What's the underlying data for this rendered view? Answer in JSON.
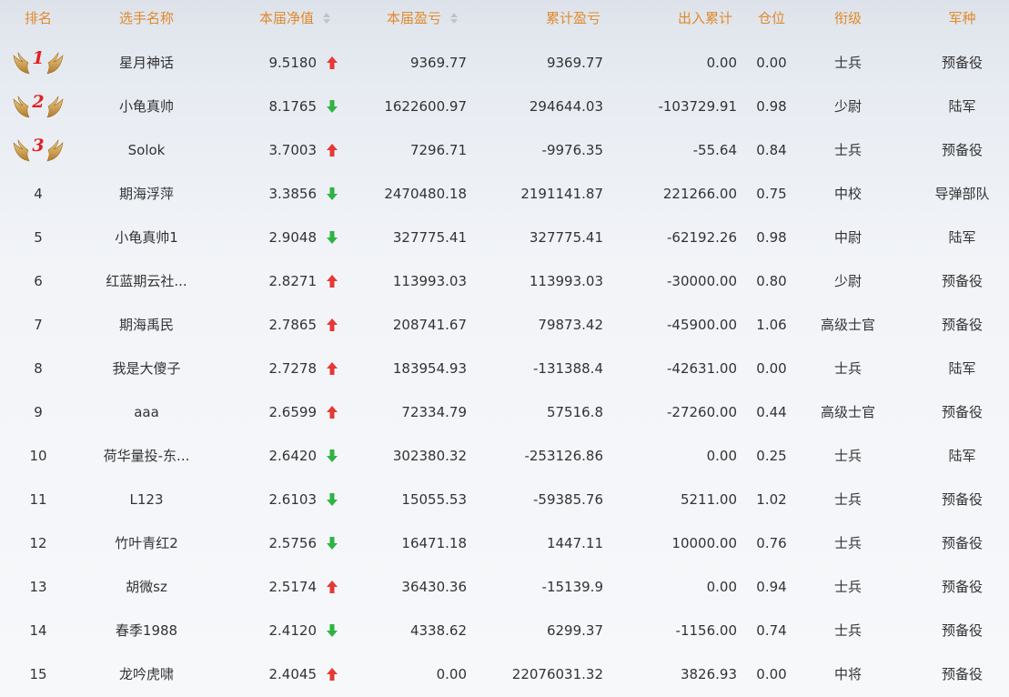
{
  "columns": {
    "rank": "排名",
    "name": "选手名称",
    "nav": "本届净值",
    "pnl": "本届盈亏",
    "cum_pnl": "累计盈亏",
    "flow": "出入累计",
    "position": "仓位",
    "title": "衔级",
    "branch": "军种"
  },
  "colors": {
    "header_text": "#e08a2c",
    "up": "#e53935",
    "down": "#2fb344",
    "medal_number": "#e02020"
  },
  "rows": [
    {
      "rank": "1",
      "medal": true,
      "name": "星月神话",
      "nav": "9.5180",
      "trend": "up",
      "pnl": "9369.77",
      "cum": "9369.77",
      "flow": "0.00",
      "pos": "0.00",
      "title": "士兵",
      "branch": "预备役"
    },
    {
      "rank": "2",
      "medal": true,
      "name": "小龟真帅",
      "nav": "8.1765",
      "trend": "down",
      "pnl": "1622600.97",
      "cum": "294644.03",
      "flow": "-103729.91",
      "pos": "0.98",
      "title": "少尉",
      "branch": "陆军"
    },
    {
      "rank": "3",
      "medal": true,
      "name": "Solok",
      "nav": "3.7003",
      "trend": "up",
      "pnl": "7296.71",
      "cum": "-9976.35",
      "flow": "-55.64",
      "pos": "0.84",
      "title": "士兵",
      "branch": "预备役"
    },
    {
      "rank": "4",
      "medal": false,
      "name": "期海浮萍",
      "nav": "3.3856",
      "trend": "down",
      "pnl": "2470480.18",
      "cum": "2191141.87",
      "flow": "221266.00",
      "pos": "0.75",
      "title": "中校",
      "branch": "导弹部队"
    },
    {
      "rank": "5",
      "medal": false,
      "name": "小龟真帅1",
      "nav": "2.9048",
      "trend": "down",
      "pnl": "327775.41",
      "cum": "327775.41",
      "flow": "-62192.26",
      "pos": "0.98",
      "title": "中尉",
      "branch": "陆军"
    },
    {
      "rank": "6",
      "medal": false,
      "name": "红蓝期云社...",
      "nav": "2.8271",
      "trend": "up",
      "pnl": "113993.03",
      "cum": "113993.03",
      "flow": "-30000.00",
      "pos": "0.80",
      "title": "少尉",
      "branch": "预备役"
    },
    {
      "rank": "7",
      "medal": false,
      "name": "期海禹民",
      "nav": "2.7865",
      "trend": "up",
      "pnl": "208741.67",
      "cum": "79873.42",
      "flow": "-45900.00",
      "pos": "1.06",
      "title": "高级士官",
      "branch": "预备役"
    },
    {
      "rank": "8",
      "medal": false,
      "name": "我是大傻子",
      "nav": "2.7278",
      "trend": "up",
      "pnl": "183954.93",
      "cum": "-131388.4",
      "flow": "-42631.00",
      "pos": "0.00",
      "title": "士兵",
      "branch": "陆军"
    },
    {
      "rank": "9",
      "medal": false,
      "name": "aaa",
      "nav": "2.6599",
      "trend": "up",
      "pnl": "72334.79",
      "cum": "57516.8",
      "flow": "-27260.00",
      "pos": "0.44",
      "title": "高级士官",
      "branch": "预备役"
    },
    {
      "rank": "10",
      "medal": false,
      "name": "荷华量投-东...",
      "nav": "2.6420",
      "trend": "down",
      "pnl": "302380.32",
      "cum": "-253126.86",
      "flow": "0.00",
      "pos": "0.25",
      "title": "士兵",
      "branch": "陆军"
    },
    {
      "rank": "11",
      "medal": false,
      "name": "L123",
      "nav": "2.6103",
      "trend": "down",
      "pnl": "15055.53",
      "cum": "-59385.76",
      "flow": "5211.00",
      "pos": "1.02",
      "title": "士兵",
      "branch": "预备役"
    },
    {
      "rank": "12",
      "medal": false,
      "name": "竹叶青红2",
      "nav": "2.5756",
      "trend": "down",
      "pnl": "16471.18",
      "cum": "1447.11",
      "flow": "10000.00",
      "pos": "0.76",
      "title": "士兵",
      "branch": "预备役"
    },
    {
      "rank": "13",
      "medal": false,
      "name": "胡微sz",
      "nav": "2.5174",
      "trend": "up",
      "pnl": "36430.36",
      "cum": "-15139.9",
      "flow": "0.00",
      "pos": "0.94",
      "title": "士兵",
      "branch": "预备役"
    },
    {
      "rank": "14",
      "medal": false,
      "name": "春季1988",
      "nav": "2.4120",
      "trend": "down",
      "pnl": "4338.62",
      "cum": "6299.37",
      "flow": "-1156.00",
      "pos": "0.74",
      "title": "士兵",
      "branch": "预备役"
    },
    {
      "rank": "15",
      "medal": false,
      "name": "龙吟虎啸",
      "nav": "2.4045",
      "trend": "up",
      "pnl": "0.00",
      "cum": "22076031.32",
      "flow": "3826.93",
      "pos": "0.00",
      "title": "中将",
      "branch": "预备役"
    }
  ]
}
